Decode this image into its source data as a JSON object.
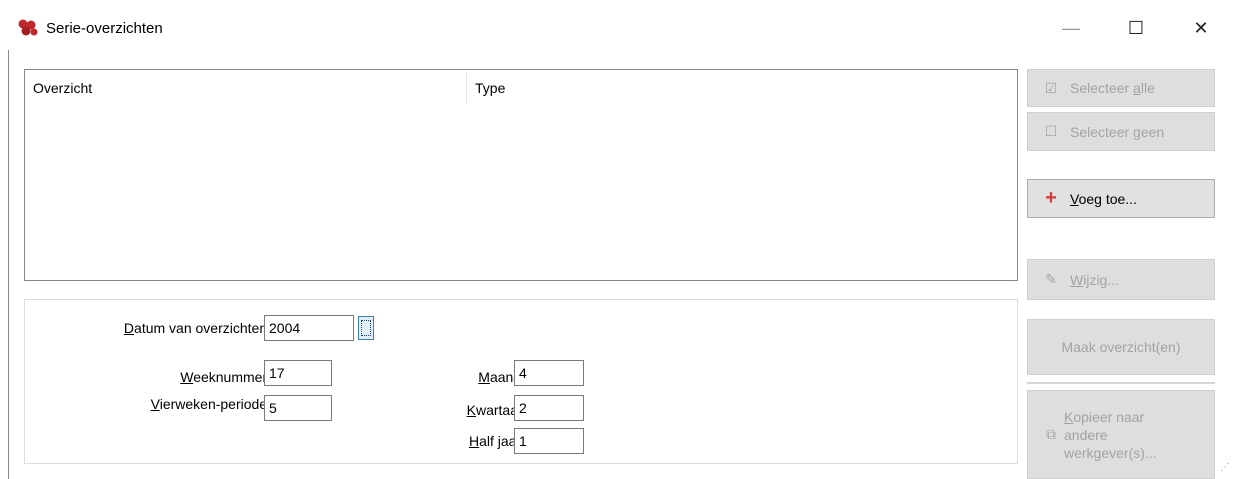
{
  "window": {
    "title": "Serie-overzichten",
    "minimize_glyph": "—",
    "maximize_glyph": "☐",
    "close_glyph": "✕",
    "icon": "app-logo-icon"
  },
  "list": {
    "columns": [
      "Overzicht",
      "Type"
    ],
    "rows": []
  },
  "form": {
    "datum_label_u": "D",
    "datum_label_rest": "atum van overzichten:",
    "datum_value": "2004",
    "week_label_u": "W",
    "week_label_rest": "eeknummer:",
    "week_value": "17",
    "vierweken_label_u": "V",
    "vierweken_label_rest": "ierweken-periode:",
    "vierweken_value": "5",
    "maand_label_u": "M",
    "maand_label_rest": "aand:",
    "maand_value": "4",
    "kwartaal_label_u": "K",
    "kwartaal_label_rest": "wartaal:",
    "kwartaal_value": "2",
    "halfjaar_label_u": "H",
    "halfjaar_label_rest": "alf jaar:",
    "halfjaar_value": "1"
  },
  "buttons": {
    "select_all_pre": "Selecteer ",
    "select_all_u": "a",
    "select_all_post": "lle",
    "select_none_pre": "Selecteer ",
    "select_none_u": "g",
    "select_none_post": "een",
    "add_u": "V",
    "add_post": "oeg toe...",
    "edit_u": "W",
    "edit_post": "ijzig...",
    "make": "Maak overzicht(en)",
    "copy_u": "K",
    "copy_line1_post": "opieer naar",
    "copy_line2": "andere",
    "copy_line3": "werkgever(s)..."
  },
  "colors": {
    "add_icon": "#d33b3b",
    "disabled_text": "#a3a3a3",
    "focus_border": "#3c7fb1"
  }
}
